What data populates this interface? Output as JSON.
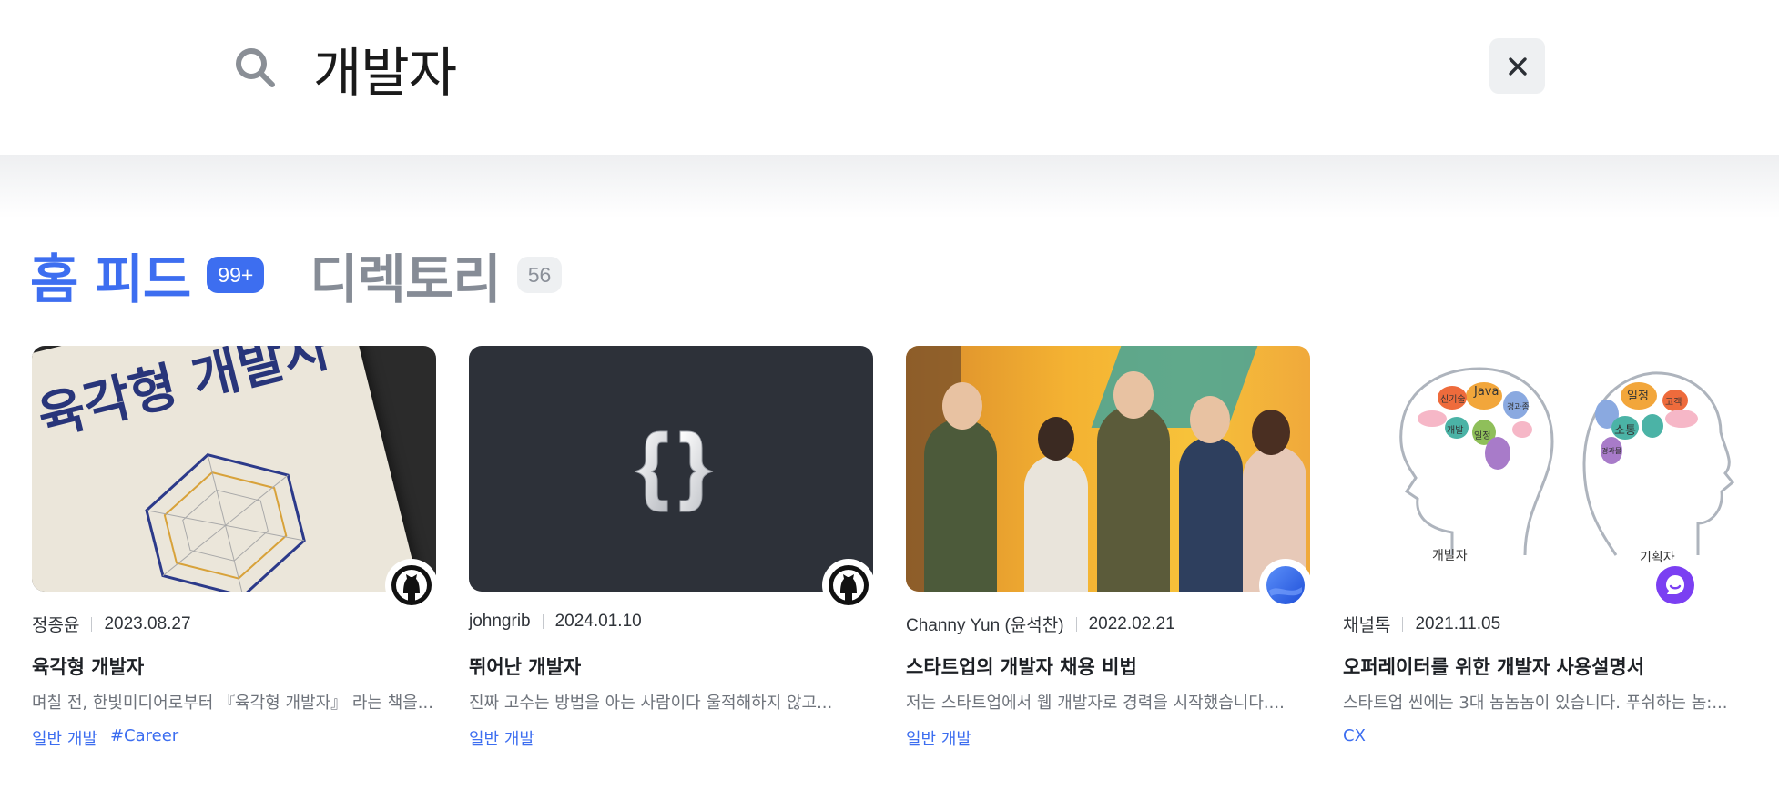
{
  "search": {
    "query": "개발자",
    "close_label": "×"
  },
  "tabs": [
    {
      "label": "홈 피드",
      "count": "99+",
      "active": true
    },
    {
      "label": "디렉토리",
      "count": "56",
      "active": false
    }
  ],
  "cards": [
    {
      "author": "정종윤",
      "date": "2023.08.27",
      "title": "육각형 개발자",
      "description": "며칠 전, 한빛미디어로부터 『육각형 개발자』 라는 책을...",
      "tags": [
        "일반 개발",
        "#Career"
      ],
      "source_icon": "github-icon",
      "thumb_text": "육각형 개발자"
    },
    {
      "author": "johngrib",
      "date": "2024.01.10",
      "title": "뛰어난 개발자",
      "description": "진짜 고수는 방법을 아는 사람이다 울적해하지 않고...",
      "tags": [
        "일반 개발"
      ],
      "source_icon": "github-icon"
    },
    {
      "author": "Channy Yun (윤석찬)",
      "date": "2022.02.21",
      "title": "스타트업의 개발자 채용 비법",
      "description": "저는 스타트업에서 웹 개발자로 경력을 시작했습니다....",
      "tags": [
        "일반 개발"
      ],
      "source_icon": "blog-icon"
    },
    {
      "author": "채널톡",
      "date": "2021.11.05",
      "title": "오퍼레이터를 위한 개발자 사용설명서",
      "description": "스타트업 씬에는 3대 놈놈놈이 있습니다. 푸쉬하는 놈:...",
      "tags": [
        "CX"
      ],
      "source_icon": "channeltalk-icon",
      "thumb_labels": {
        "left": "개발자",
        "right": "기획자",
        "left_words": [
          "Java",
          "신기술",
          "경과종",
          "개발",
          "일정"
        ],
        "right_words": [
          "일정",
          "고객",
          "소통",
          "경과물"
        ]
      }
    }
  ],
  "colors": {
    "accent": "#3d6ef0",
    "badge_inactive": "#eef0f2",
    "tag": "#3d6ef0"
  }
}
